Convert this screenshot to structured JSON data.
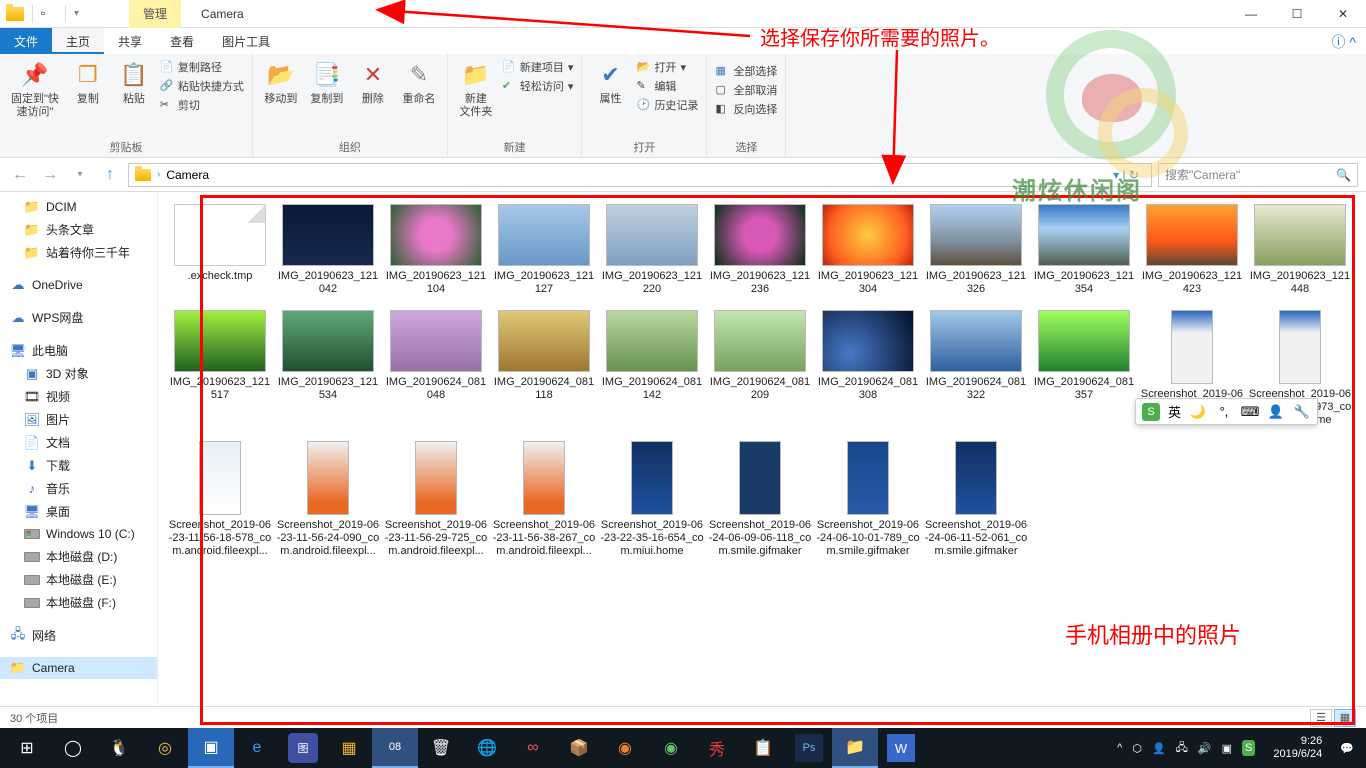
{
  "window": {
    "manage_tab": "管理",
    "title": "Camera",
    "min": "—",
    "max": "☐",
    "close": "✕"
  },
  "tabs": {
    "file": "文件",
    "home": "主页",
    "share": "共享",
    "view": "查看",
    "pictools": "图片工具"
  },
  "ribbon": {
    "clipboard": {
      "pin": "固定到\"快\n速访问\"",
      "copy": "复制",
      "paste": "粘贴",
      "copypath": "复制路径",
      "pasteshortcut": "粘贴快捷方式",
      "cut": "剪切",
      "label": "剪贴板"
    },
    "organize": {
      "moveto": "移动到",
      "copyto": "复制到",
      "delete": "删除",
      "rename": "重命名",
      "label": "组织"
    },
    "new": {
      "newfolder": "新建\n文件夹",
      "newitem": "新建项目",
      "easyaccess": "轻松访问",
      "label": "新建"
    },
    "open": {
      "properties": "属性",
      "open": "打开",
      "edit": "编辑",
      "history": "历史记录",
      "label": "打开"
    },
    "select": {
      "selectall": "全部选择",
      "selectnone": "全部取消",
      "invert": "反向选择",
      "label": "选择"
    }
  },
  "nav": {
    "breadcrumb": "Camera",
    "search_placeholder": "搜索\"Camera\""
  },
  "sidebar": {
    "dcim": "DCIM",
    "toutiao": "头条文章",
    "zhanzhe": "站着待你三千年",
    "onedrive": "OneDrive",
    "wps": "WPS网盘",
    "thispc": "此电脑",
    "objects3d": "3D 对象",
    "videos": "视频",
    "pictures": "图片",
    "documents": "文档",
    "downloads": "下载",
    "music": "音乐",
    "desktop": "桌面",
    "win10c": "Windows 10 (C:)",
    "diskd": "本地磁盘 (D:)",
    "diske": "本地磁盘 (E:)",
    "diskf": "本地磁盘 (F:)",
    "network": "网络",
    "camera": "Camera"
  },
  "files": [
    {
      "name": ".excheck.tmp",
      "thumb": "doc"
    },
    {
      "name": "IMG_20190623_121042",
      "thumb": "tg1"
    },
    {
      "name": "IMG_20190623_121104",
      "thumb": "tg2"
    },
    {
      "name": "IMG_20190623_121127",
      "thumb": "tg3"
    },
    {
      "name": "IMG_20190623_121220",
      "thumb": "tg4"
    },
    {
      "name": "IMG_20190623_121236",
      "thumb": "tg5"
    },
    {
      "name": "IMG_20190623_121304",
      "thumb": "tg6"
    },
    {
      "name": "IMG_20190623_121326",
      "thumb": "tg7"
    },
    {
      "name": "IMG_20190623_121354",
      "thumb": "tg8"
    },
    {
      "name": "IMG_20190623_121423",
      "thumb": "tg9"
    },
    {
      "name": "IMG_20190623_121448",
      "thumb": "tg10"
    },
    {
      "name": "IMG_20190623_121517",
      "thumb": "tg11"
    },
    {
      "name": "IMG_20190623_121534",
      "thumb": "tg12"
    },
    {
      "name": "IMG_20190624_081048",
      "thumb": "tg13"
    },
    {
      "name": "IMG_20190624_081118",
      "thumb": "tg14"
    },
    {
      "name": "IMG_20190624_081142",
      "thumb": "tg15"
    },
    {
      "name": "IMG_20190624_081209",
      "thumb": "tg16"
    },
    {
      "name": "IMG_20190624_081308",
      "thumb": "tg17"
    },
    {
      "name": "IMG_20190624_081322",
      "thumb": "tg18"
    },
    {
      "name": "IMG_20190624_081357",
      "thumb": "tg19"
    },
    {
      "name": "Screenshot_2019-06-23-11-56-00-666_com.miui.home",
      "thumb": "ts1",
      "portrait": true
    },
    {
      "name": "Screenshot_2019-06-23-11-56-04-973_com.miui.home",
      "thumb": "ts1",
      "portrait": true
    },
    {
      "name": "Screenshot_2019-06-23-11-56-18-578_com.android.fileexpl...",
      "thumb": "ts4",
      "portrait": true
    },
    {
      "name": "Screenshot_2019-06-23-11-56-24-090_com.android.fileexpl...",
      "thumb": "ts2",
      "portrait": true
    },
    {
      "name": "Screenshot_2019-06-23-11-56-29-725_com.android.fileexpl...",
      "thumb": "ts2",
      "portrait": true
    },
    {
      "name": "Screenshot_2019-06-23-11-56-38-267_com.android.fileexpl...",
      "thumb": "ts2",
      "portrait": true
    },
    {
      "name": "Screenshot_2019-06-23-22-35-16-654_com.miui.home",
      "thumb": "ts3",
      "portrait": true
    },
    {
      "name": "Screenshot_2019-06-24-06-09-06-118_com.smile.gifmaker",
      "thumb": "ts5",
      "portrait": true
    },
    {
      "name": "Screenshot_2019-06-24-06-10-01-789_com.smile.gifmaker",
      "thumb": "ts6",
      "portrait": true
    },
    {
      "name": "Screenshot_2019-06-24-06-11-52-061_com.smile.gifmaker",
      "thumb": "ts7",
      "portrait": true
    }
  ],
  "annotations": {
    "top_text": "选择保存你所需要的照片。",
    "bottom_text": "手机相册中的照片"
  },
  "watermark_text": "潮炫休闲阁",
  "status": {
    "count": "30 个项目"
  },
  "ime": {
    "lang": "英"
  },
  "taskbar": {
    "time": "9:26",
    "date": "2019/6/24"
  }
}
